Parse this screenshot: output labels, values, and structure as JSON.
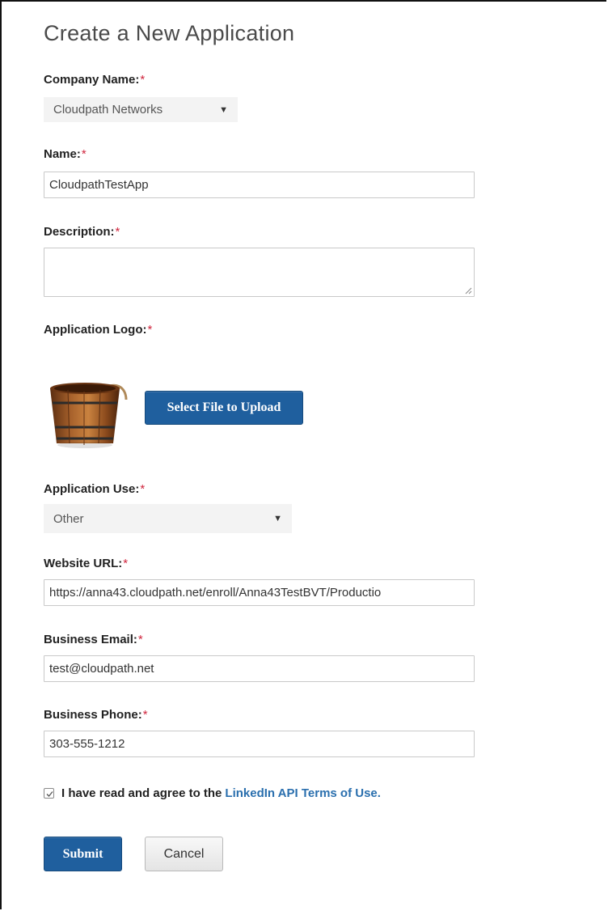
{
  "form": {
    "title": "Create a New Application",
    "required_marker": "*",
    "company_name": {
      "label": "Company Name:",
      "selected": "Cloudpath Networks"
    },
    "name": {
      "label": "Name:",
      "value": "CloudpathTestApp"
    },
    "description": {
      "label": "Description:",
      "value": ""
    },
    "application_logo": {
      "label": "Application Logo:",
      "upload_button": "Select File to Upload"
    },
    "application_use": {
      "label": "Application Use:",
      "selected": "Other"
    },
    "website_url": {
      "label": "Website URL:",
      "value": "https://anna43.cloudpath.net/enroll/Anna43TestBVT/Productio"
    },
    "business_email": {
      "label": "Business Email:",
      "value": "test@cloudpath.net"
    },
    "business_phone": {
      "label": "Business Phone:",
      "value": "303-555-1212"
    },
    "terms": {
      "checked": true,
      "text": "I have read and agree to the",
      "link_text": "LinkedIn API Terms of Use."
    },
    "submit_label": "Submit",
    "cancel_label": "Cancel"
  },
  "colors": {
    "primary_button": "#1f5f9e",
    "required": "#d0263e",
    "link": "#2a6fae"
  },
  "icons": {
    "dropdown": "chevron-down-icon",
    "logo": "bucket-logo-icon",
    "checkbox": "checkmark-icon"
  }
}
